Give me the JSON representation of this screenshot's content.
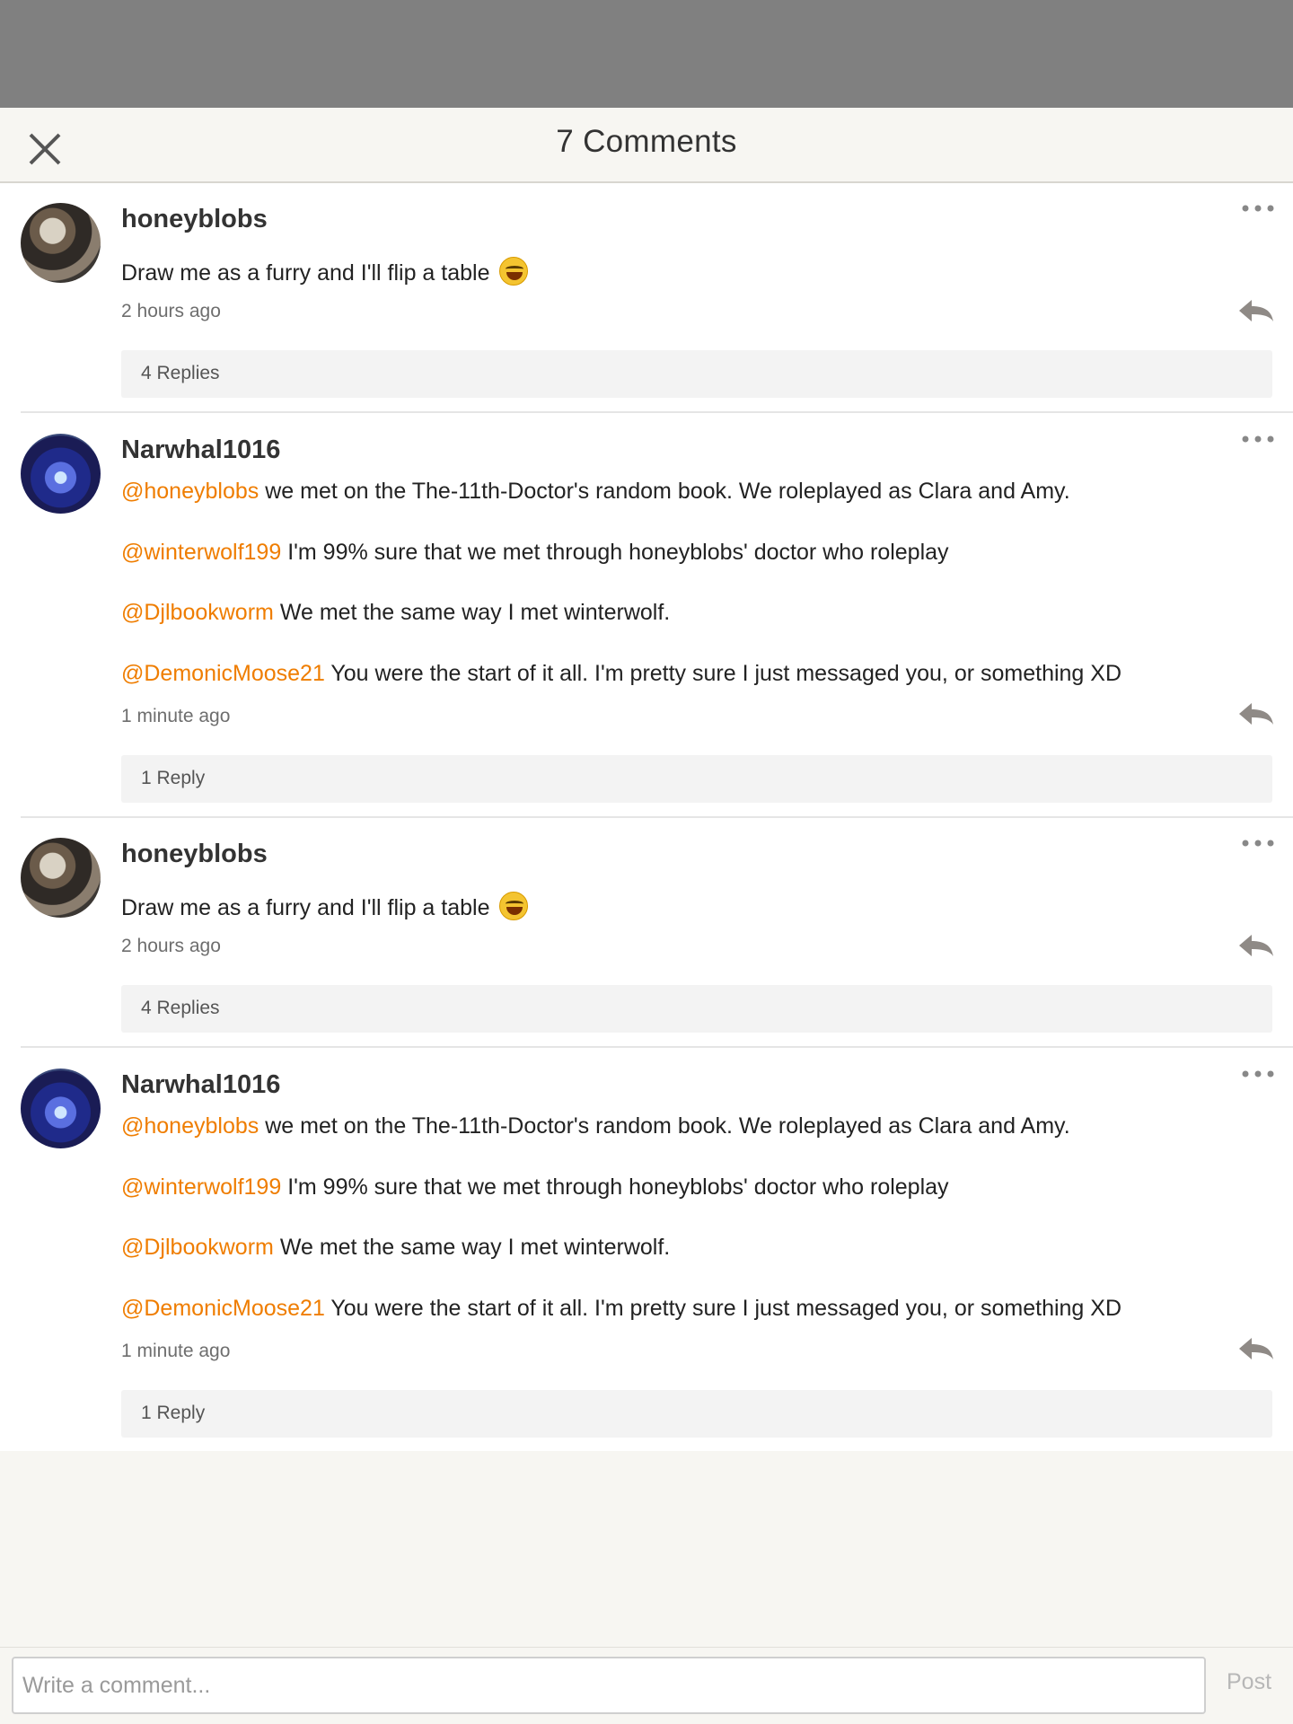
{
  "header": {
    "title": "7 Comments",
    "close_icon": "close-icon"
  },
  "comments": [
    {
      "username": "honeyblobs",
      "text": "Draw me as a furry and I'll flip a table",
      "emoji": "laughing-tears-emoji",
      "time": "2 hours ago",
      "replies": "4 Replies"
    },
    {
      "username": "Narwhal1016",
      "paragraphs": [
        {
          "mention": "@honeyblobs",
          "text": " we met on the The-11th-Doctor's random book. We roleplayed as Clara and Amy."
        },
        {
          "mention": "@winterwolf199",
          "text": " I'm 99% sure that we met through honeyblobs' doctor who roleplay"
        },
        {
          "mention": "@Djlbookworm",
          "text": " We met the same way I met winterwolf."
        },
        {
          "mention": "@DemonicMoose21",
          "text": " You were the start of it all. I'm pretty sure I just messaged you, or something XD"
        }
      ],
      "time": "1 minute ago",
      "replies": "1 Reply"
    },
    {
      "username": "honeyblobs",
      "text": "Draw me as a furry and I'll flip a table",
      "emoji": "laughing-tears-emoji",
      "time": "2 hours ago",
      "replies": "4 Replies"
    },
    {
      "username": "Narwhal1016",
      "paragraphs": [
        {
          "mention": "@honeyblobs",
          "text": " we met on the The-11th-Doctor's random book. We roleplayed as Clara and Amy."
        },
        {
          "mention": "@winterwolf199",
          "text": " I'm 99% sure that we met through honeyblobs' doctor who roleplay"
        },
        {
          "mention": "@Djlbookworm",
          "text": " We met the same way I met winterwolf."
        },
        {
          "mention": "@DemonicMoose21",
          "text": " You were the start of it all. I'm pretty sure I just messaged you, or something XD"
        }
      ],
      "time": "1 minute ago",
      "replies": "1 Reply"
    }
  ],
  "composer": {
    "placeholder": "Write a comment...",
    "post_label": "Post"
  },
  "colors": {
    "mention": "#ef7d00",
    "background": "#f7f6f2",
    "overlay": "#808080"
  }
}
